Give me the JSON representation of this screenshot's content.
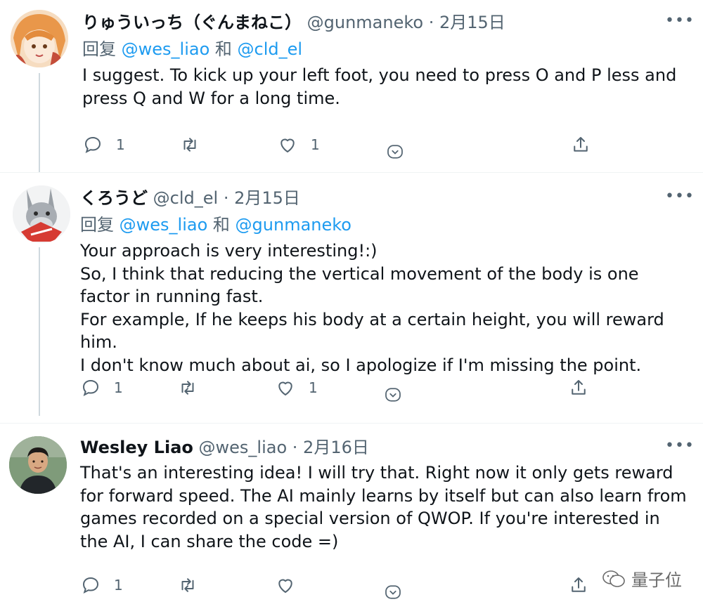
{
  "tweets": [
    {
      "display_name": "りゅういっち（ぐんまねこ）",
      "handle": "@gunmaneko",
      "date": "· 2月15日",
      "reply_prefix": "回复",
      "reply_mention_1": "@wes_liao",
      "reply_joiner": "和",
      "reply_mention_2": "@cld_el",
      "text_lines": [
        "I suggest. To kick up your left foot, you need to press O and P less and press Q and W for a long time."
      ],
      "reply_count": "1",
      "retweet_count": "",
      "like_count": "1",
      "avatar_icon": "anime-avatar"
    },
    {
      "display_name": "くろうど",
      "handle": "@cld_el",
      "date": "· 2月15日",
      "reply_prefix": "回复",
      "reply_mention_1": "@wes_liao",
      "reply_joiner": "和",
      "reply_mention_2": "@gunmaneko",
      "text_lines": [
        "Your approach is very interesting!:)",
        "So, I think that reducing the vertical movement of the body is one factor in running fast.",
        "For example, If he keeps his body at a certain height, you will reward him.",
        "I don't know much about ai, so I apologize if I'm missing the point."
      ],
      "reply_count": "1",
      "retweet_count": "",
      "like_count": "1",
      "avatar_icon": "donkey-avatar"
    },
    {
      "display_name": "Wesley Liao",
      "handle": "@wes_liao",
      "date": "· 2月16日",
      "text_lines": [
        "That's an interesting idea! I will try that. Right now it only gets reward for forward speed. The AI mainly learns by itself but can also learn from games recorded on a special version of QWOP. If you're interested in the AI, I can share the code =)"
      ],
      "reply_count": "1",
      "retweet_count": "",
      "like_count": "",
      "avatar_icon": "person-avatar"
    }
  ],
  "more_glyph": "•••",
  "watermark": {
    "text": "量子位",
    "icon": "wechat-icon"
  },
  "colors": {
    "accent": "#1d9bf0",
    "secondary_text": "#536471",
    "primary_text": "#0f1419"
  }
}
